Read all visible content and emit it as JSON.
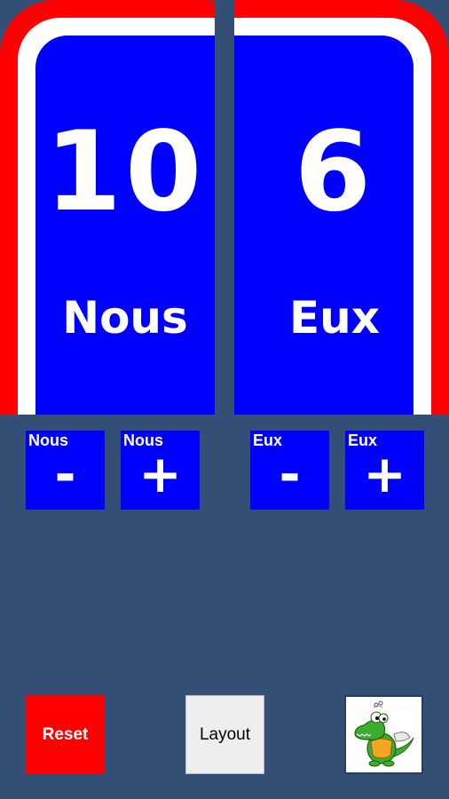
{
  "colors": {
    "team_color": "#0000ff",
    "reset_color": "#ff0000",
    "background": "#344f75"
  },
  "home": {
    "score": "10",
    "name": "Nous",
    "minus_label": "Nous",
    "plus_label": "Nous",
    "minus_symbol": "-",
    "plus_symbol": "+"
  },
  "away": {
    "score": "6",
    "name": "Eux",
    "minus_label": "Eux",
    "plus_label": "Eux",
    "minus_symbol": "-",
    "plus_symbol": "+"
  },
  "buttons": {
    "reset": "Reset",
    "layout": "Layout"
  },
  "mascot": {
    "icon": "crocodile-mascot-icon"
  }
}
